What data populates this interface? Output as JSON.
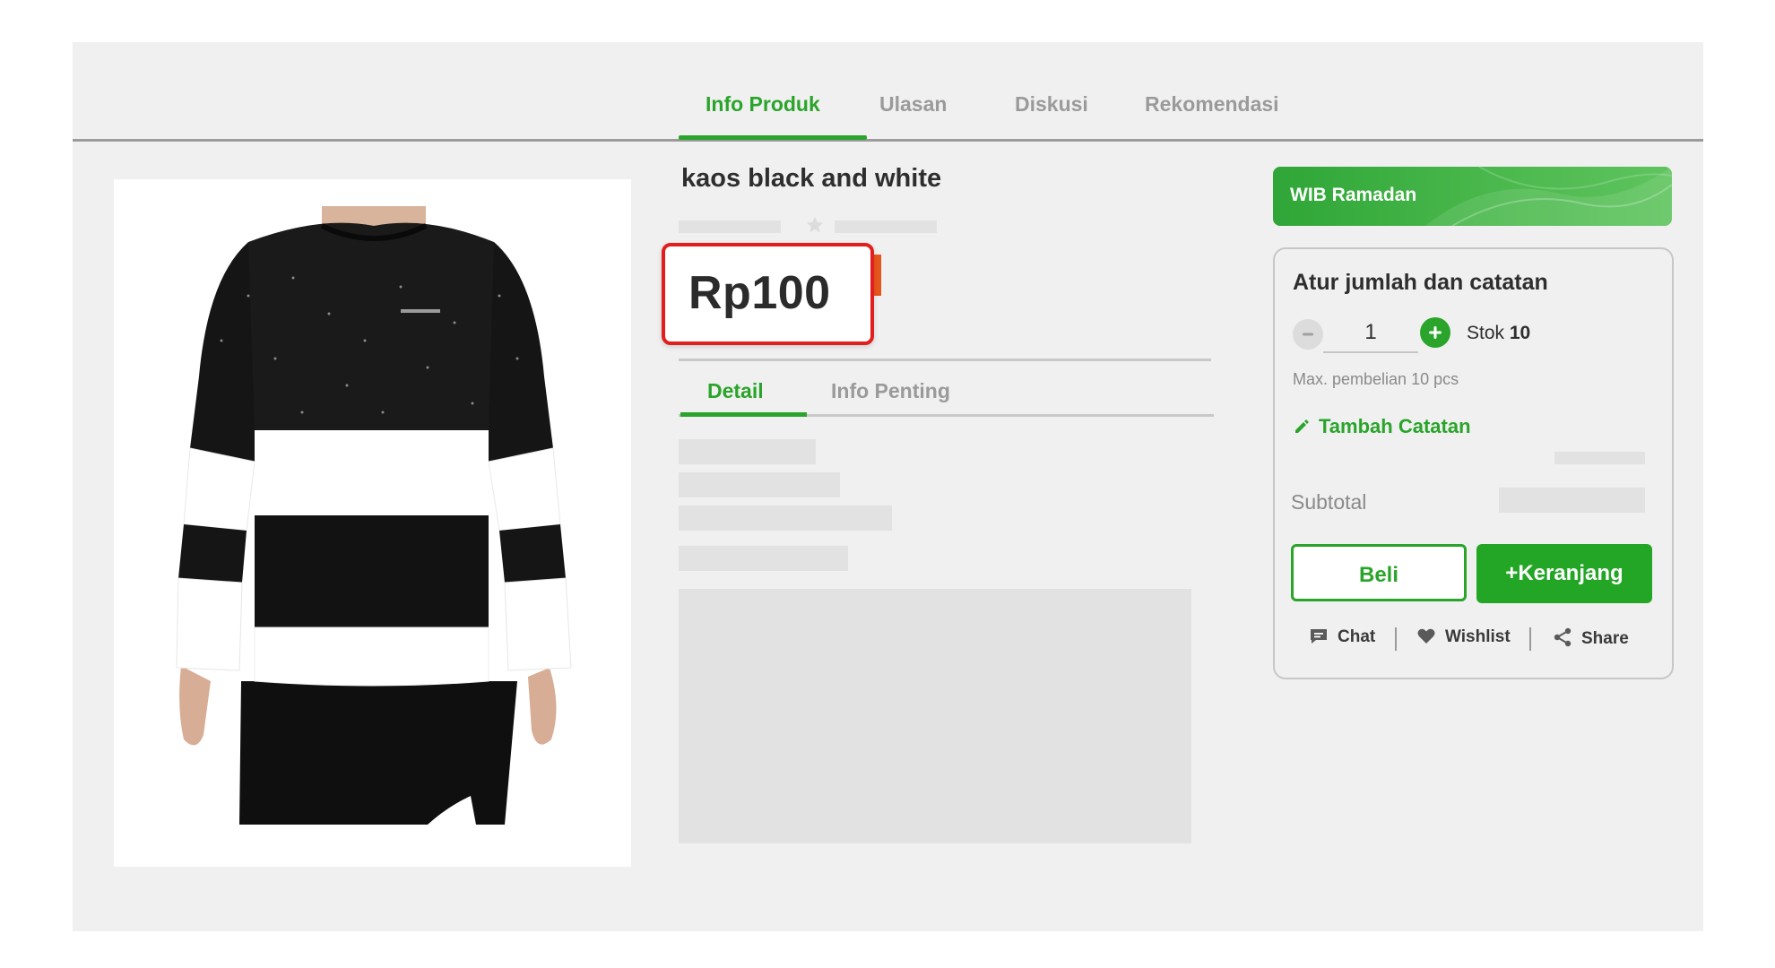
{
  "tabs": [
    {
      "label": "Info Produk",
      "active": true
    },
    {
      "label": "Ulasan",
      "active": false
    },
    {
      "label": "Diskusi",
      "active": false
    },
    {
      "label": "Rekomendasi",
      "active": false
    }
  ],
  "product": {
    "title": "kaos black and white",
    "price": "Rp100"
  },
  "detail_tabs": [
    {
      "label": "Detail",
      "active": true
    },
    {
      "label": "Info Penting",
      "active": false
    }
  ],
  "promo": {
    "label": "WIB Ramadan"
  },
  "purchase": {
    "title": "Atur jumlah dan catatan",
    "quantity": "1",
    "stock_label": "Stok",
    "stock_count": "10",
    "max_text": "Max. pembelian 10 pcs",
    "add_note": "Tambah Catatan",
    "subtotal_label": "Subtotal",
    "buy_label": "Beli",
    "cart_label": "+Keranjang"
  },
  "actions": {
    "chat": "Chat",
    "wishlist": "Wishlist",
    "share": "Share"
  },
  "colors": {
    "accent": "#2aa42a",
    "highlight": "#e21e1e",
    "price_accent": "#e8551a",
    "background": "#f0f0f0"
  },
  "icons": [
    "star-icon",
    "pencil-icon",
    "chat-icon",
    "heart-icon",
    "share-icon",
    "minus-icon",
    "plus-icon"
  ]
}
